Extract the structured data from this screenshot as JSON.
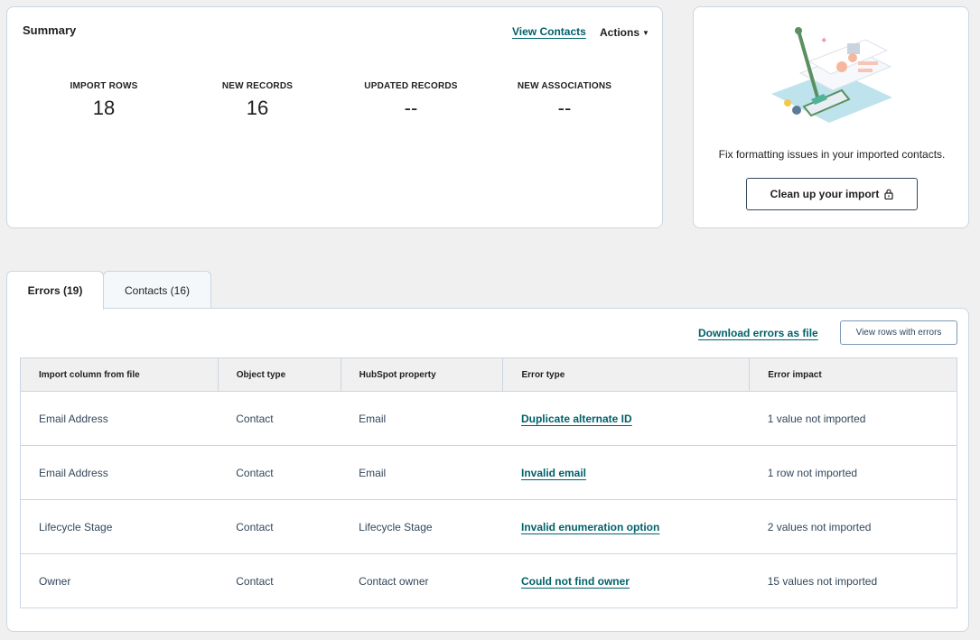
{
  "summary": {
    "title": "Summary",
    "view_contacts": "View Contacts",
    "actions": "Actions",
    "stats": [
      {
        "label": "IMPORT ROWS",
        "value": "18"
      },
      {
        "label": "NEW RECORDS",
        "value": "16"
      },
      {
        "label": "UPDATED RECORDS",
        "value": "--"
      },
      {
        "label": "NEW ASSOCIATIONS",
        "value": "--"
      }
    ]
  },
  "promo": {
    "text": "Fix formatting issues in your imported contacts.",
    "button": "Clean up your import",
    "button_icon": "lock-icon"
  },
  "tabs": [
    {
      "label": "Errors (19)",
      "active": true
    },
    {
      "label": "Contacts (16)",
      "active": false
    }
  ],
  "errors_panel": {
    "download": "Download errors as file",
    "view_rows": "View rows with errors",
    "columns": [
      "Import column from file",
      "Object type",
      "HubSpot property",
      "Error type",
      "Error impact"
    ],
    "rows": [
      {
        "column": "Email Address",
        "object": "Contact",
        "property": "Email",
        "error": "Duplicate alternate ID",
        "impact": "1 value not imported"
      },
      {
        "column": "Email Address",
        "object": "Contact",
        "property": "Email",
        "error": "Invalid email",
        "impact": "1 row not imported"
      },
      {
        "column": "Lifecycle Stage",
        "object": "Contact",
        "property": "Lifecycle Stage",
        "error": "Invalid enumeration option",
        "impact": "2 values not imported"
      },
      {
        "column": "Owner",
        "object": "Contact",
        "property": "Contact owner",
        "error": "Could not find owner",
        "impact": "15 values not imported"
      }
    ]
  },
  "colors": {
    "link": "#00616a",
    "border": "#cbd6e2",
    "background": "#f0f0f0"
  }
}
